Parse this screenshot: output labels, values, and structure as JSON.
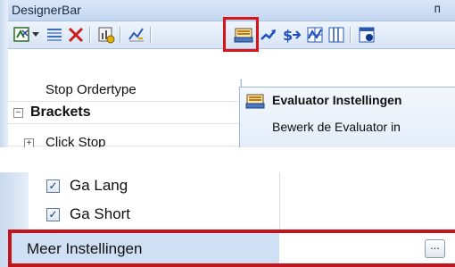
{
  "panel": {
    "title": "DesignerBar",
    "pin_glyph": "ᴨ"
  },
  "toolbar": {
    "buttons": [
      {
        "icon": "formula-icon"
      },
      {
        "icon": "dropdown-arrow-icon"
      },
      {
        "icon": "list-lines-icon"
      },
      {
        "icon": "delete-x-icon"
      },
      {
        "icon": "chart-gear-icon"
      },
      {
        "icon": "line-chart-icon"
      },
      {
        "icon": "evaluator-settings-icon"
      },
      {
        "icon": "trend-arrow-icon"
      },
      {
        "icon": "dollar-arrow-icon"
      },
      {
        "icon": "grid-chart-icon"
      },
      {
        "icon": "columns-icon"
      },
      {
        "icon": "properties-icon"
      }
    ]
  },
  "grid_top": {
    "rows": [
      {
        "label": "Stop Ordertype"
      },
      {
        "label": "Brackets",
        "expander": "−"
      },
      {
        "label": "Click Stop",
        "expander": "+"
      }
    ]
  },
  "menu": {
    "title": "Evaluator Instellingen",
    "description": "Bewerk de Evaluator in"
  },
  "grid_bottom": {
    "rows": [
      {
        "label": "Ga Lang",
        "checked": "✓"
      },
      {
        "label": "Ga Short",
        "checked": "✓"
      }
    ],
    "meer": {
      "label": "Meer Instellingen",
      "button": "..."
    }
  },
  "colors": {
    "highlight_red": "#d8141b",
    "selected_row": "#cfe0f5",
    "toolbar_blue": "#d7e4f5"
  }
}
